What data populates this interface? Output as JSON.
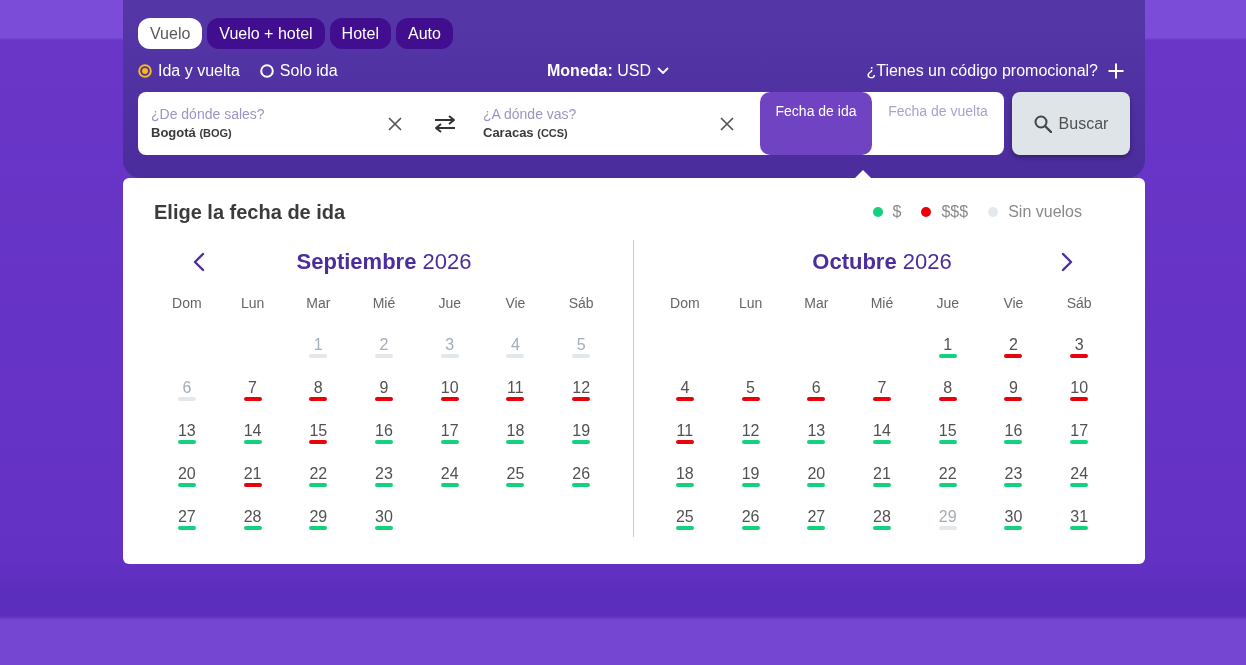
{
  "tabs": [
    {
      "label": "Vuelo",
      "selected": true
    },
    {
      "label": "Vuelo + hotel",
      "selected": false
    },
    {
      "label": "Hotel",
      "selected": false
    },
    {
      "label": "Auto",
      "selected": false
    }
  ],
  "trip_types": [
    {
      "label": "Ida y vuelta",
      "selected": true
    },
    {
      "label": "Solo ida",
      "selected": false
    }
  ],
  "currency": {
    "label": "Moneda:",
    "value": "USD"
  },
  "promo_code": {
    "label": "¿Tienes un código promocional?"
  },
  "search": {
    "origin": {
      "label": "¿De dónde sales?",
      "city": "Bogotá",
      "code": "(BOG)"
    },
    "destination": {
      "label": "¿A dónde vas?",
      "city": "Caracas",
      "code": "(CCS)"
    },
    "dates": [
      {
        "label": "Fecha de ida",
        "selected": true
      },
      {
        "label": "Fecha de vuelta",
        "selected": false
      }
    ],
    "button": "Buscar"
  },
  "calendar": {
    "title": "Elige la fecha de ida",
    "legend": [
      {
        "kind": "low",
        "label": "$",
        "color": "#13d17c"
      },
      {
        "kind": "high",
        "label": "$$$",
        "color": "#e8000b"
      },
      {
        "kind": "none",
        "label": "Sin vuelos",
        "color": "#e3e8ec"
      }
    ],
    "months": [
      {
        "title": "**Septiembre** 2026",
        "weekdays": [
          "Dom",
          "Lun",
          "Mar",
          "Mié",
          "Jue",
          "Vie",
          "Sáb"
        ],
        "weeks": [
          [
            {
              "day": "1",
              "kind": "none"
            },
            {
              "day": "2",
              "kind": "none"
            },
            {
              "day": "3",
              "kind": "none"
            },
            {
              "day": "4",
              "kind": "none"
            },
            {
              "day": "5",
              "kind": "none"
            }
          ],
          [
            {
              "day": "6",
              "kind": "none"
            },
            {
              "day": "7",
              "kind": "high"
            },
            {
              "day": "8",
              "kind": "high"
            },
            {
              "day": "9",
              "kind": "high"
            },
            {
              "day": "10",
              "kind": "high"
            },
            {
              "day": "11",
              "kind": "high"
            },
            {
              "day": "12",
              "kind": "high"
            }
          ],
          [
            {
              "day": "13",
              "kind": "low"
            },
            {
              "day": "14",
              "kind": "low"
            },
            {
              "day": "15",
              "kind": "high"
            },
            {
              "day": "16",
              "kind": "low"
            },
            {
              "day": "17",
              "kind": "low"
            },
            {
              "day": "18",
              "kind": "low"
            },
            {
              "day": "19",
              "kind": "low"
            }
          ],
          [
            {
              "day": "20",
              "kind": "low"
            },
            {
              "day": "21",
              "kind": "high"
            },
            {
              "day": "22",
              "kind": "low"
            },
            {
              "day": "23",
              "kind": "low"
            },
            {
              "day": "24",
              "kind": "low"
            },
            {
              "day": "25",
              "kind": "low"
            },
            {
              "day": "26",
              "kind": "low"
            }
          ],
          [
            {
              "day": "27",
              "kind": "low"
            },
            {
              "day": "28",
              "kind": "low"
            },
            {
              "day": "29",
              "kind": "low"
            },
            {
              "day": "30",
              "kind": "low"
            }
          ]
        ]
      },
      {
        "title": "**Octubre** 2026",
        "weekdays": [
          "Dom",
          "Lun",
          "Mar",
          "Mié",
          "Jue",
          "Vie",
          "Sáb"
        ],
        "weeks": [
          [
            {
              "day": "1",
              "kind": "low"
            },
            {
              "day": "2",
              "kind": "high"
            },
            {
              "day": "3",
              "kind": "high"
            }
          ],
          [
            {
              "day": "4",
              "kind": "high"
            },
            {
              "day": "5",
              "kind": "high"
            },
            {
              "day": "6",
              "kind": "high"
            },
            {
              "day": "7",
              "kind": "high"
            },
            {
              "day": "8",
              "kind": "high"
            },
            {
              "day": "9",
              "kind": "high"
            },
            {
              "day": "10",
              "kind": "high"
            }
          ],
          [
            {
              "day": "11",
              "kind": "high"
            },
            {
              "day": "12",
              "kind": "low"
            },
            {
              "day": "13",
              "kind": "low"
            },
            {
              "day": "14",
              "kind": "low"
            },
            {
              "day": "15",
              "kind": "low"
            },
            {
              "day": "16",
              "kind": "low"
            },
            {
              "day": "17",
              "kind": "low"
            }
          ],
          [
            {
              "day": "18",
              "kind": "low"
            },
            {
              "day": "19",
              "kind": "low"
            },
            {
              "day": "20",
              "kind": "low"
            },
            {
              "day": "21",
              "kind": "low"
            },
            {
              "day": "22",
              "kind": "low"
            },
            {
              "day": "23",
              "kind": "low"
            },
            {
              "day": "24",
              "kind": "low"
            }
          ],
          [
            {
              "day": "25",
              "kind": "low"
            },
            {
              "day": "26",
              "kind": "low"
            },
            {
              "day": "27",
              "kind": "low"
            },
            {
              "day": "28",
              "kind": "low"
            },
            {
              "day": "29",
              "kind": "none"
            },
            {
              "day": "30",
              "kind": "low"
            },
            {
              "day": "31",
              "kind": "low"
            }
          ]
        ]
      }
    ]
  }
}
